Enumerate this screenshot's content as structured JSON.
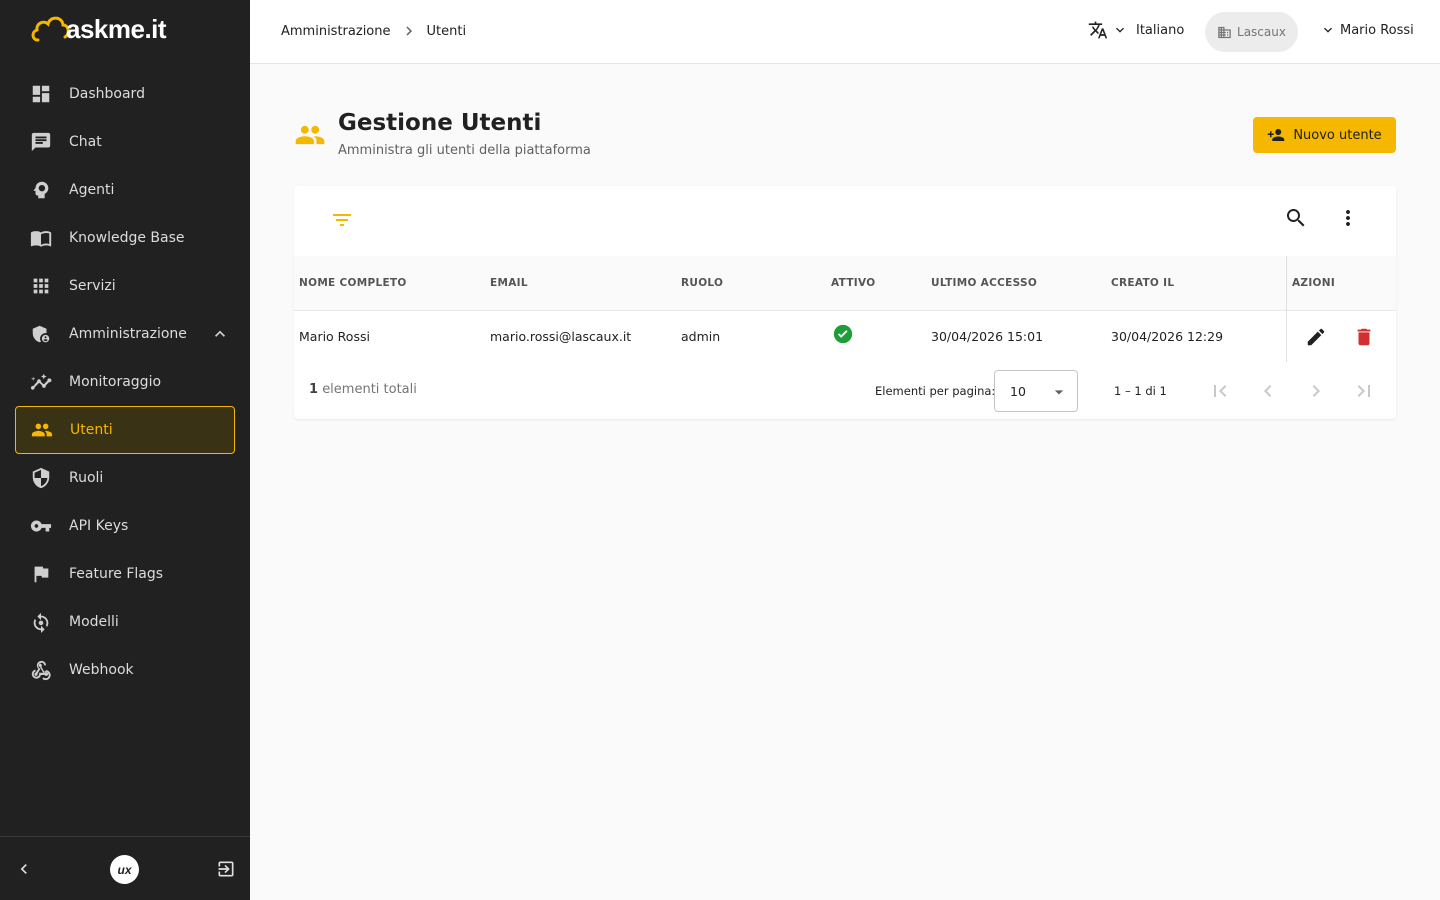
{
  "brand": {
    "name": "askme.it",
    "footer_logo": "ux"
  },
  "sidebar": {
    "items": [
      {
        "label": "Dashboard",
        "icon": "dashboard-icon"
      },
      {
        "label": "Chat",
        "icon": "chat-icon"
      },
      {
        "label": "Agenti",
        "icon": "agent-icon"
      },
      {
        "label": "Knowledge Base",
        "icon": "book-icon"
      },
      {
        "label": "Servizi",
        "icon": "apps-icon"
      },
      {
        "label": "Amministrazione",
        "icon": "admin-shield-icon",
        "expanded": true
      },
      {
        "label": "Monitoraggio",
        "icon": "monitoring-icon"
      },
      {
        "label": "Utenti",
        "icon": "people-icon",
        "active": true
      },
      {
        "label": "Ruoli",
        "icon": "shield-icon"
      },
      {
        "label": "API Keys",
        "icon": "key-icon"
      },
      {
        "label": "Feature Flags",
        "icon": "flag-icon"
      },
      {
        "label": "Modelli",
        "icon": "model-icon"
      },
      {
        "label": "Webhook",
        "icon": "webhook-icon"
      }
    ]
  },
  "topbar": {
    "breadcrumb": [
      "Amministrazione",
      "Utenti"
    ],
    "language": "Italiano",
    "tenant": "Lascaux",
    "user": "Mario Rossi"
  },
  "page": {
    "title": "Gestione Utenti",
    "subtitle": "Amministra gli utenti della piattaforma",
    "new_button": "Nuovo utente"
  },
  "table": {
    "columns": [
      "NOME COMPLETO",
      "EMAIL",
      "RUOLO",
      "ATTIVO",
      "ULTIMO ACCESSO",
      "CREATO IL",
      "AZIONI"
    ],
    "rows": [
      {
        "name": "Mario Rossi",
        "email": "mario.rossi@lascaux.it",
        "role": "admin",
        "active": true,
        "last_access": "30/04/2026 15:01",
        "created": "30/04/2026 12:29"
      }
    ]
  },
  "footer": {
    "total_count": "1",
    "total_label": "elementi totali",
    "per_page_label": "Elementi per pagina:",
    "per_page_value": "10",
    "range": "1 – 1 di 1"
  },
  "colors": {
    "accent": "#f5b700",
    "sidebar_bg": "#212121",
    "success": "#1e9e3a",
    "danger": "#d32f2f"
  }
}
